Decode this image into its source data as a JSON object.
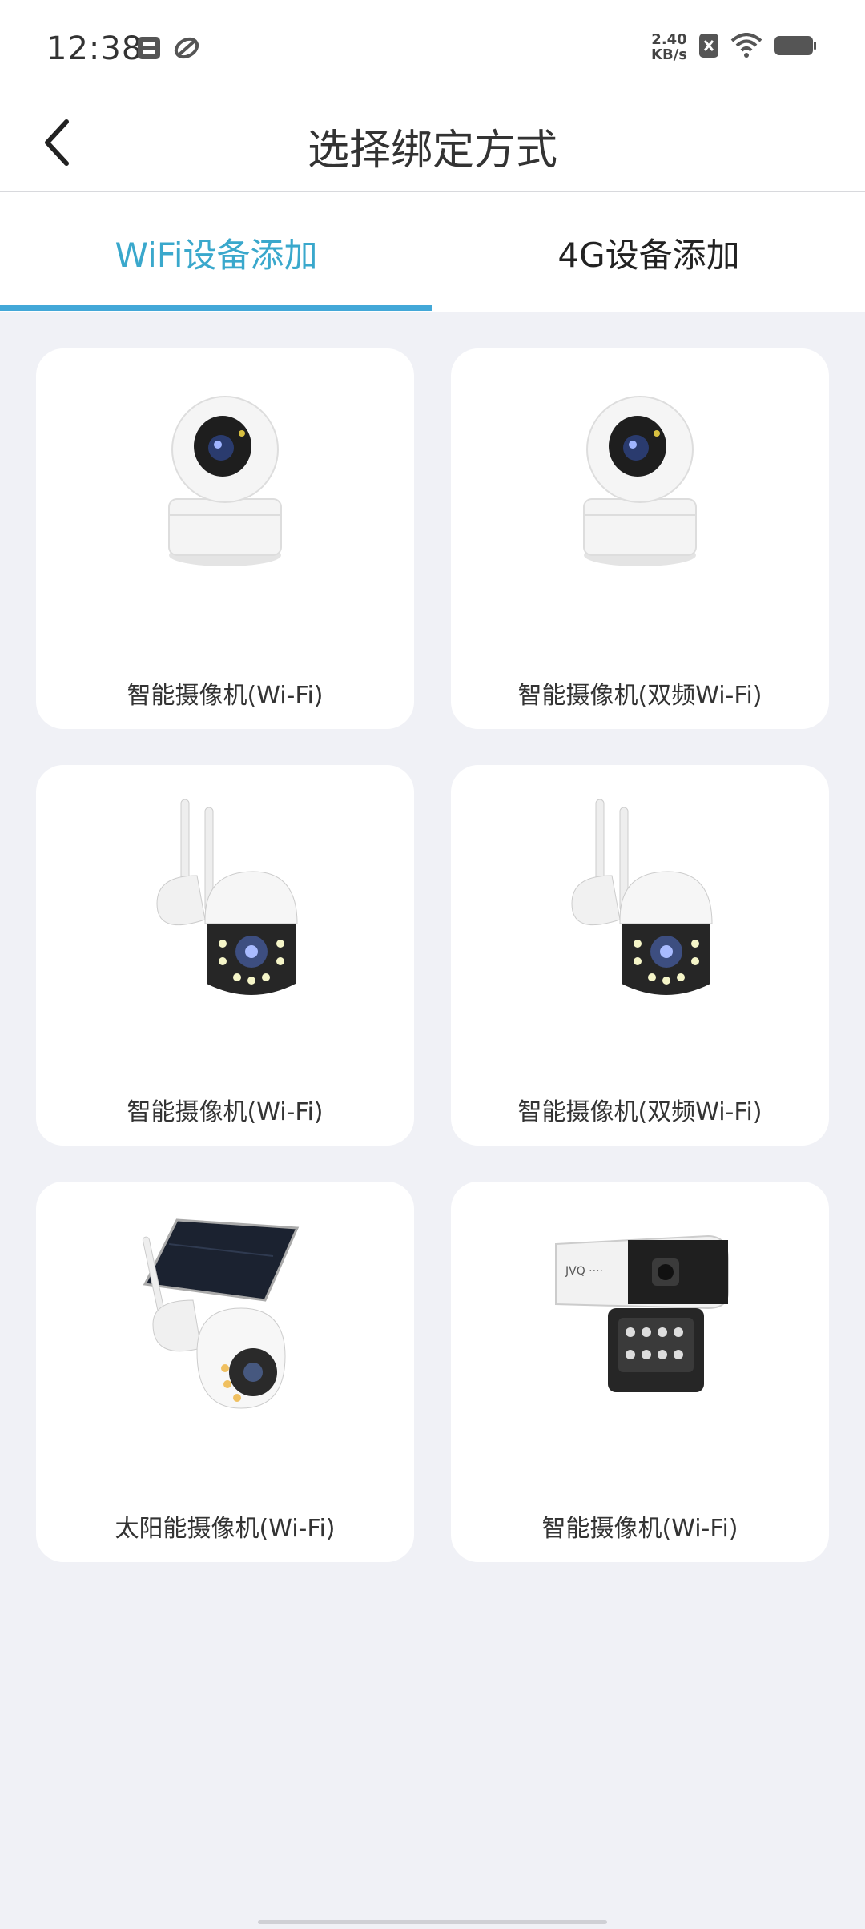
{
  "status_bar": {
    "time": "12:38",
    "net_speed_value": "2.40",
    "net_speed_unit": "KB/s",
    "icons": [
      "storage-icon",
      "sync-icon",
      "sim-x-icon",
      "wifi-icon",
      "battery-icon"
    ]
  },
  "header": {
    "title": "选择绑定方式",
    "back_icon": "chevron-left-icon"
  },
  "tabs": [
    {
      "label": "WiFi设备添加",
      "active": true
    },
    {
      "label": "4G设备添加",
      "active": false
    }
  ],
  "colors": {
    "accent": "#43a8d8",
    "background": "#f0f1f6",
    "card": "#ffffff"
  },
  "devices": [
    {
      "label": "智能摄像机(Wi-Fi)",
      "icon": "ptz-indoor-camera-icon"
    },
    {
      "label": "智能摄像机(双频Wi-Fi)",
      "icon": "ptz-indoor-camera-icon"
    },
    {
      "label": "智能摄像机(Wi-Fi)",
      "icon": "outdoor-ptz-camera-icon"
    },
    {
      "label": "智能摄像机(双频Wi-Fi)",
      "icon": "outdoor-ptz-camera-icon"
    },
    {
      "label": "太阳能摄像机(Wi-Fi)",
      "icon": "solar-camera-icon"
    },
    {
      "label": "智能摄像机(Wi-Fi)",
      "icon": "bullet-camera-icon"
    }
  ]
}
